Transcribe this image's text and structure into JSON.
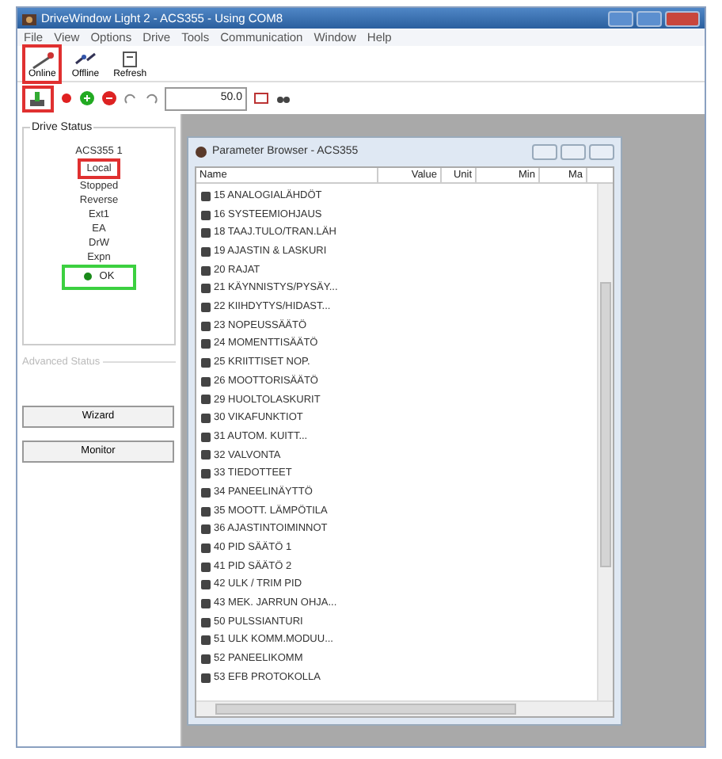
{
  "window": {
    "title": "DriveWindow Light 2 - ACS355 - Using COM8"
  },
  "menu": [
    "File",
    "View",
    "Options",
    "Drive",
    "Tools",
    "Communication",
    "Window",
    "Help"
  ],
  "toolbar": [
    {
      "label": "Online",
      "highlighted": true
    },
    {
      "label": "Offline",
      "highlighted": false
    },
    {
      "label": "Refresh",
      "highlighted": false
    }
  ],
  "toolbar_2": {
    "connect_highlighted": true,
    "reference_value": "50.0"
  },
  "drive_status": {
    "title": "Drive Status",
    "items": [
      {
        "text": "ACS355 1",
        "highlighted": false
      },
      {
        "text": "Local",
        "highlighted": true
      },
      {
        "text": "Stopped",
        "highlighted": false
      },
      {
        "text": "Reverse",
        "highlighted": false
      },
      {
        "text": "Ext1",
        "highlighted": false
      },
      {
        "text": "EA",
        "highlighted": false
      },
      {
        "text": "DrW",
        "highlighted": false
      },
      {
        "text": "Expn",
        "highlighted": false
      }
    ],
    "state": {
      "text": "OK",
      "color": "#1a8a1a",
      "highlighted": true
    }
  },
  "advanced_status": {
    "title": "Advanced Status"
  },
  "buttons": [
    "Wizard",
    "Monitor"
  ],
  "parameter_browser": {
    "title": "Parameter Browser - ACS355",
    "columns": [
      "Name",
      "Value",
      "Unit",
      "Min",
      "Ma"
    ],
    "groups": [
      "15 ANALOGIALÄHDÖT",
      "16 SYSTEEMIOHJAUS",
      "18 TAAJ.TULO/TRAN.LÄH",
      "19 AJASTIN & LASKURI",
      "20 RAJAT",
      "21 KÄYNNISTYS/PYSÄY...",
      "22 KIIHDYTYS/HIDAST...",
      "23 NOPEUSSÄÄTÖ",
      "24 MOMENTTISÄÄTÖ",
      "25 KRIITTISET NOP.",
      "26 MOOTTORISÄÄTÖ",
      "29 HUOLTOLASKURIT",
      "30 VIKAFUNKTIOT",
      "31 AUTOM. KUITT...",
      "32 VALVONTA",
      "33 TIEDOTTEET",
      "34 PANEELINÄYTTÖ",
      "35 MOOTT. LÄMPÖTILA",
      "36 AJASTINTOIMINNOT",
      "40 PID SÄÄTÖ 1",
      "41 PID SÄÄTÖ 2",
      "42 ULK / TRIM PID",
      "43 MEK. JARRUN OHJA...",
      "50 PULSSIANTURI",
      "51 ULK KOMM.MODUU...",
      "52 PANEELIKOMM",
      "53 EFB PROTOKOLLA"
    ]
  }
}
